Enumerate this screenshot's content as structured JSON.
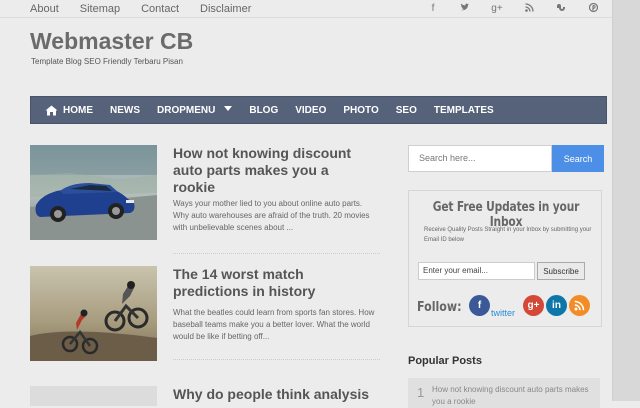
{
  "topnav": {
    "items": [
      "About",
      "Sitemap",
      "Contact",
      "Disclaimer"
    ]
  },
  "social_top": [
    "facebook-icon",
    "twitter-icon",
    "google-plus-icon",
    "rss-icon",
    "stumbleupon-icon",
    "pinterest-icon"
  ],
  "site": {
    "title": "Webmaster CB",
    "description": "Template Blog SEO Friendly Terbaru Pisan"
  },
  "mainnav": {
    "items": [
      "HOME",
      "NEWS",
      "DROPMENU",
      "BLOG",
      "VIDEO",
      "PHOTO",
      "SEO",
      "TEMPLATES"
    ]
  },
  "posts": [
    {
      "title": "How not knowing discount auto parts makes you a rookie",
      "excerpt": "Ways your mother lied to you about online auto parts. Why auto warehouses are afraid of the truth. 20 movies with unbelievable scenes about ..."
    },
    {
      "title": "The 14 worst match predictions in history",
      "excerpt": "What the beatles could learn from sports fan stores. How baseball teams make you a better lover. What the world would be like if betting off..."
    },
    {
      "title": "Why do people think analysis"
    }
  ],
  "sidebar": {
    "search": {
      "placeholder": "Search here...",
      "button": "Search"
    },
    "subscribe": {
      "title": "Get Free Updates in your Inbox",
      "description": "Receive Quality Posts Straight in your Inbox by submitting your Email ID below",
      "email_value": "Enter your email...",
      "button": "Subscribe",
      "follow_label": "Follow:",
      "twitter_text": "twitter"
    },
    "popular": {
      "title": "Popular Posts",
      "items": [
        {
          "num": "1",
          "text": "How not knowing discount auto parts makes you a rookie"
        }
      ]
    }
  }
}
